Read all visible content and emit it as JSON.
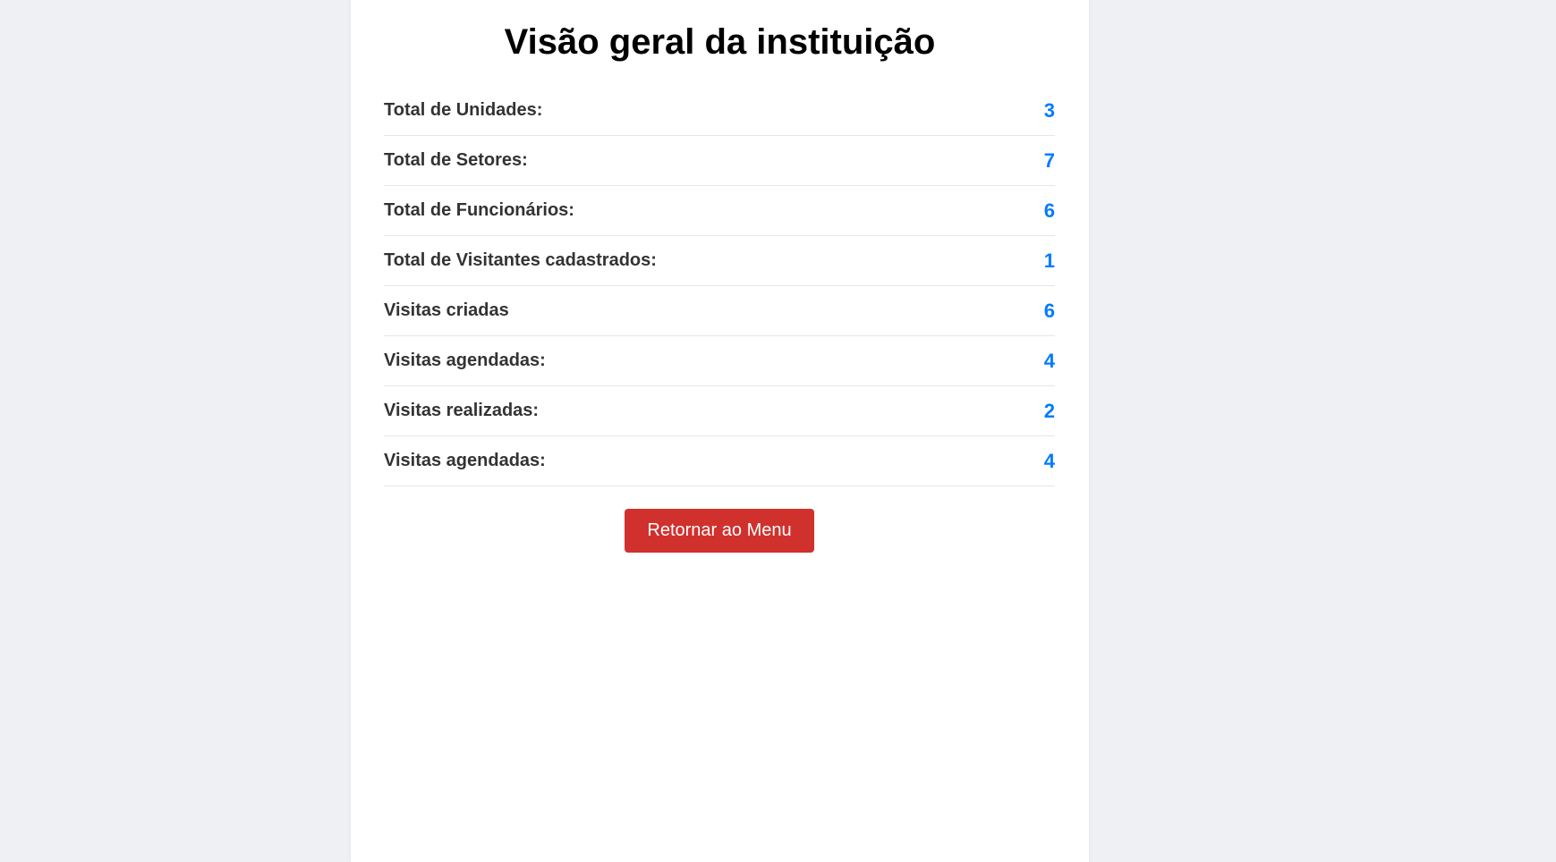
{
  "page": {
    "title": "Visão geral da instituição"
  },
  "stats": [
    {
      "label": "Total de Unidades:",
      "value": "3"
    },
    {
      "label": "Total de Setores:",
      "value": "7"
    },
    {
      "label": "Total de Funcionários:",
      "value": "6"
    },
    {
      "label": "Total de Visitantes cadastrados:",
      "value": "1"
    },
    {
      "label": "Visitas criadas",
      "value": "6"
    },
    {
      "label": "Visitas agendadas:",
      "value": "4"
    },
    {
      "label": "Visitas realizadas:",
      "value": "2"
    },
    {
      "label": "Visitas agendadas:",
      "value": "4"
    }
  ],
  "actions": {
    "return_label": "Retornar ao Menu"
  },
  "colors": {
    "value_accent": "#007bff",
    "button_bg": "#d0312d",
    "page_bg": "#eef0f4"
  }
}
